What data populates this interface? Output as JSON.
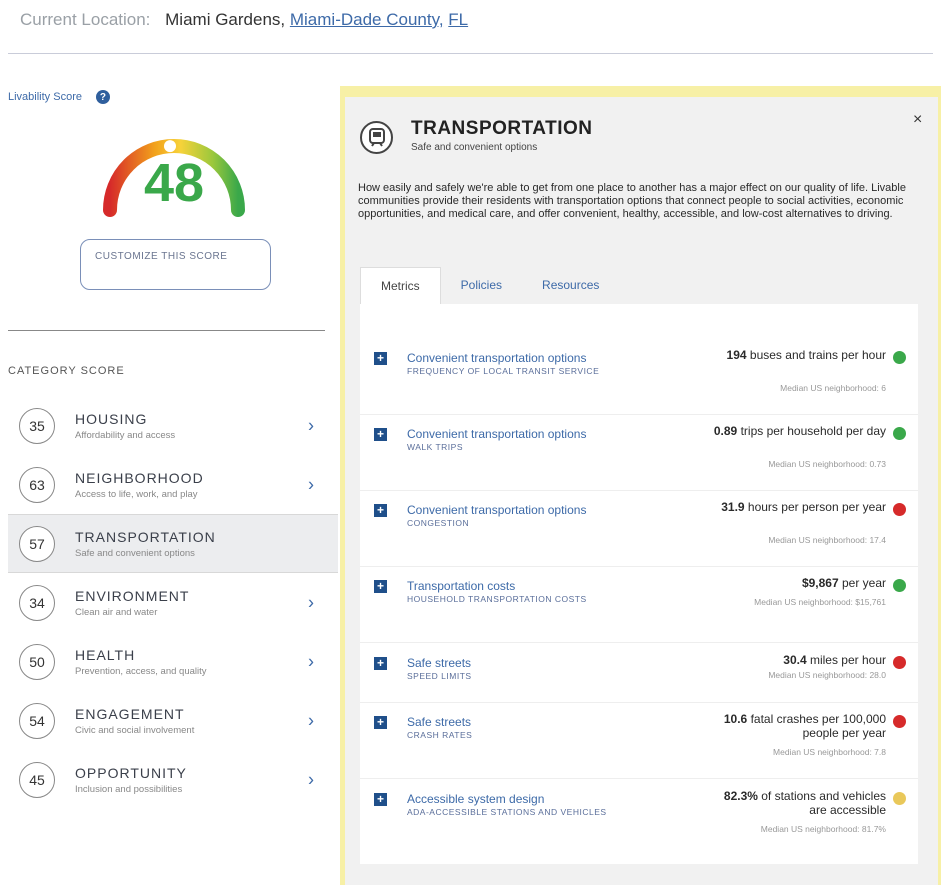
{
  "location": {
    "label": "Current Location:",
    "city": "Miami Gardens,",
    "county": "Miami-Dade County,",
    "state": "FL"
  },
  "livability": {
    "label": "Livability Score",
    "help": "?",
    "score": "48",
    "score_value": 48,
    "customize_label": "CUSTOMIZE THIS SCORE"
  },
  "category_title": "CATEGORY SCORE",
  "categories": [
    {
      "score": "35",
      "name": "HOUSING",
      "sub": "Affordability and access",
      "arrow": "›"
    },
    {
      "score": "63",
      "name": "NEIGHBORHOOD",
      "sub": "Access to life, work, and play",
      "arrow": "›"
    },
    {
      "score": "57",
      "name": "TRANSPORTATION",
      "sub": "Safe and convenient options",
      "arrow": ""
    },
    {
      "score": "34",
      "name": "ENVIRONMENT",
      "sub": "Clean air and water",
      "arrow": "›"
    },
    {
      "score": "50",
      "name": "HEALTH",
      "sub": "Prevention, access, and quality",
      "arrow": "›"
    },
    {
      "score": "54",
      "name": "ENGAGEMENT",
      "sub": "Civic and social involvement",
      "arrow": "›"
    },
    {
      "score": "45",
      "name": "OPPORTUNITY",
      "sub": "Inclusion and possibilities",
      "arrow": "›"
    }
  ],
  "panel": {
    "close": "×",
    "title": "TRANSPORTATION",
    "subtitle": "Safe and convenient options",
    "description": "How easily and safely we're able to get from one place to another has a major effect on our quality of life. Livable communities provide their residents with transportation options that connect people to social activities, economic opportunities, and medical care, and offer convenient, healthy, accessible, and low-cost alternatives to driving.",
    "tabs": [
      "Metrics",
      "Policies",
      "Resources"
    ]
  },
  "colors": {
    "green": "#3aa84a",
    "red": "#d62a2a",
    "yellow": "#e9c85a",
    "accent": "#3d6aa8"
  },
  "metrics": [
    {
      "plus": "+",
      "title": "Convenient transportation options",
      "sub": "FREQUENCY OF LOCAL TRANSIT SERVICE",
      "value": "194",
      "unit": " buses and trains per hour",
      "median": "Median US neighborhood: 6",
      "status": "green"
    },
    {
      "plus": "+",
      "title": "Convenient transportation options",
      "sub": "WALK TRIPS",
      "value": "0.89",
      "unit": " trips per household per day",
      "median": "Median US neighborhood: 0.73",
      "status": "green"
    },
    {
      "plus": "+",
      "title": "Convenient transportation options",
      "sub": "CONGESTION",
      "value": "31.9",
      "unit": " hours per person per year",
      "median": "Median US neighborhood: 17.4",
      "status": "red"
    },
    {
      "plus": "+",
      "title": "Transportation costs",
      "sub": "HOUSEHOLD TRANSPORTATION COSTS",
      "value": "$9,867",
      "unit": " per year",
      "median": "Median US neighborhood: $15,761",
      "status": "green"
    },
    {
      "plus": "+",
      "title": "Safe streets",
      "sub": "SPEED LIMITS",
      "value": "30.4",
      "unit": " miles per hour",
      "median": "Median US neighborhood: 28.0",
      "status": "red"
    },
    {
      "plus": "+",
      "title": "Safe streets",
      "sub": "CRASH RATES",
      "value": "10.6",
      "unit": " fatal crashes per 100,000 people per year",
      "median": "Median US neighborhood: 7.8",
      "status": "red"
    },
    {
      "plus": "+",
      "title": "Accessible system design",
      "sub": "ADA-ACCESSIBLE STATIONS AND VEHICLES",
      "value": "82.3%",
      "unit": " of stations and vehicles are accessible",
      "median": "Median US neighborhood: 81.7%",
      "status": "yellow"
    }
  ]
}
